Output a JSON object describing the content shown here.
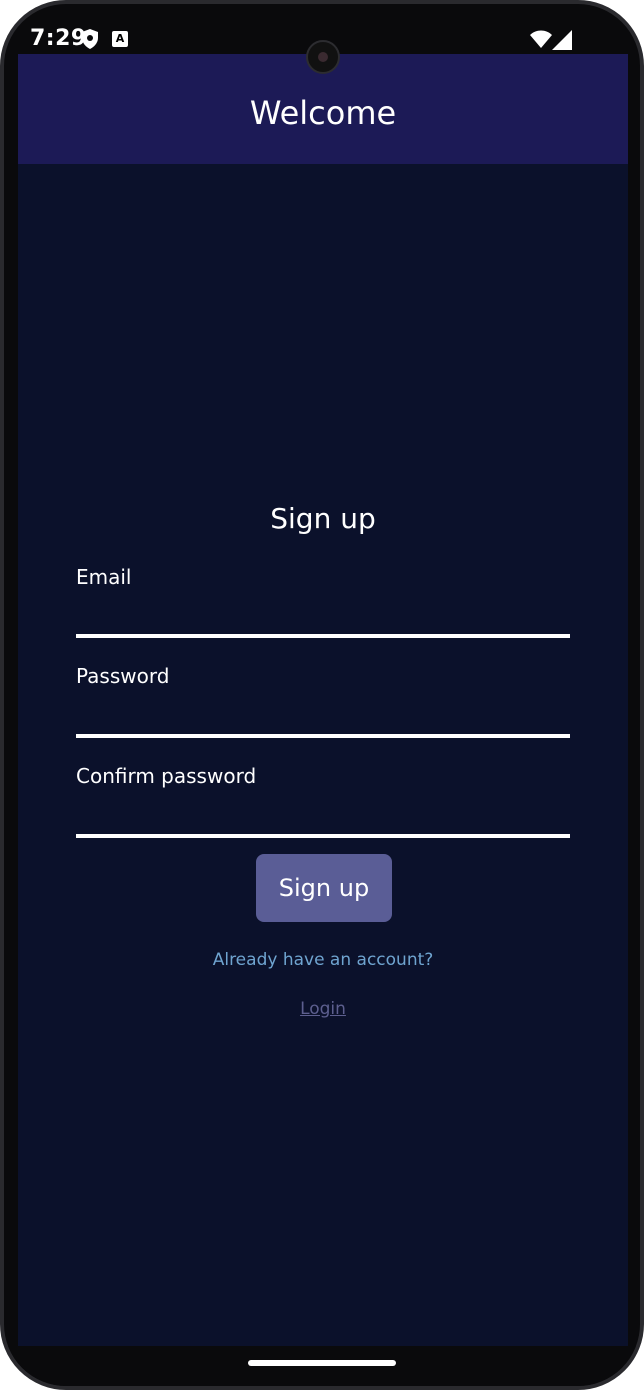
{
  "status_bar": {
    "time": "7:29",
    "app_icon_letter": "A"
  },
  "app_bar": {
    "title": "Welcome"
  },
  "form": {
    "title": "Sign up",
    "email_label": "Email",
    "email_value": "",
    "password_label": "Password",
    "password_value": "",
    "confirm_label": "Confirm password",
    "confirm_value": "",
    "submit_label": "Sign up",
    "already_text": "Already have an account?",
    "login_label": "Login"
  },
  "colors": {
    "app_bar": "#1c1a56",
    "background": "#0b112b",
    "button": "#5a5d96",
    "link_text": "#6fa4d0",
    "login_link": "#5d5f8f"
  }
}
